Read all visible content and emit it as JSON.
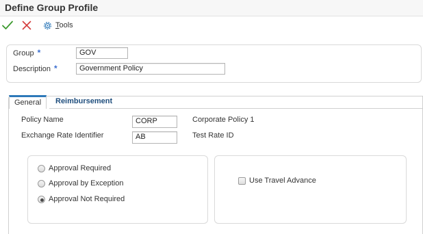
{
  "window": {
    "title": "Define Group Profile"
  },
  "toolbar": {
    "ok_icon": "checkmark-icon",
    "cancel_icon": "close-icon",
    "tools_icon": "gear-icon",
    "tools_first": "T",
    "tools_rest": "ools"
  },
  "header": {
    "group_label": "Group",
    "group_value": "GOV",
    "description_label": "Description",
    "description_value": "Government Policy",
    "required_marker": "*"
  },
  "tabs": [
    {
      "label": "General",
      "active": true
    },
    {
      "label": "Reimbursement",
      "active": false
    }
  ],
  "general": {
    "policy_name_label": "Policy Name",
    "policy_name_value": "CORP",
    "policy_name_desc": "Corporate Policy 1",
    "exchange_rate_label": "Exchange Rate Identifier",
    "exchange_rate_value": "AB",
    "exchange_rate_desc": "Test Rate ID",
    "approval_options": [
      {
        "label": "Approval Required",
        "selected": false
      },
      {
        "label": "Approval by Exception",
        "selected": false
      },
      {
        "label": "Approval Not Required",
        "selected": true
      }
    ],
    "use_travel_advance": {
      "label": "Use Travel Advance",
      "checked": false
    }
  },
  "colors": {
    "ok_green": "#3c9a2e",
    "cancel_red": "#d43b3b",
    "required_blue": "#3b6ecf",
    "tab_accent": "#2e79b9",
    "link_blue": "#1f4e7d"
  }
}
